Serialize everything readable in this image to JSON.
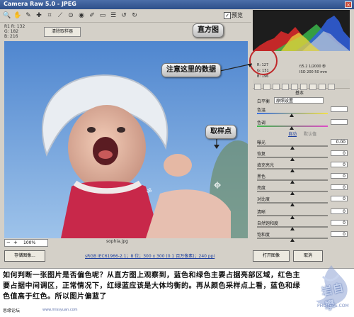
{
  "window": {
    "title": "Camera Raw 5.0 - JPEG",
    "close_glyph": "×",
    "preview_label": "预览",
    "preview_checked": "✓"
  },
  "toolbar": {
    "tools": [
      {
        "name": "zoom-tool-icon",
        "glyph": "🔍"
      },
      {
        "name": "hand-tool-icon",
        "glyph": "✋"
      },
      {
        "name": "white-balance-tool-icon",
        "glyph": "✎"
      },
      {
        "name": "color-sampler-tool-icon",
        "glyph": "✚"
      },
      {
        "name": "crop-tool-icon",
        "glyph": "⌗"
      },
      {
        "name": "straighten-tool-icon",
        "glyph": "⟋"
      },
      {
        "name": "spot-removal-tool-icon",
        "glyph": "⊙"
      },
      {
        "name": "red-eye-tool-icon",
        "glyph": "◉"
      },
      {
        "name": "adjustment-brush-icon",
        "glyph": "✐"
      },
      {
        "name": "gradient-filter-icon",
        "glyph": "▭"
      },
      {
        "name": "preferences-icon",
        "glyph": "☰"
      },
      {
        "name": "rotate-left-icon",
        "glyph": "↺"
      },
      {
        "name": "rotate-right-icon",
        "glyph": "↻"
      }
    ]
  },
  "sampler_info": {
    "line1": "R1  R: 132",
    "line2": "G: 182",
    "line3": "B: 216",
    "clear_button": "清除取样器"
  },
  "image": {
    "filename": "sophia.jpg",
    "zoom_minus": "−",
    "zoom_plus": "+",
    "zoom_value": "100%"
  },
  "bottom": {
    "save_button": "存储图像...",
    "link_info": "sRGB IEC61966-2.1；8 位；300 x 300 (0.1 百万像素)；240 ppi",
    "open_button": "打开图像",
    "cancel_button": "取消"
  },
  "right_panel": {
    "rgb_r": "R:  127",
    "rgb_g": "G:  151",
    "rgb_b": "B:  196",
    "exif_line1": "f/5.2    1/2000 秒",
    "exif_line2": "ISO 200    50 mm",
    "section_title": "基本",
    "wb_label": "白平衡",
    "wb_value": "原照设置",
    "params": [
      {
        "label": "色温",
        "value": ""
      },
      {
        "label": "色调",
        "value": ""
      },
      {
        "label": "曝光",
        "value": "0.00"
      },
      {
        "label": "恢复",
        "value": "0"
      },
      {
        "label": "填充亮光",
        "value": "0"
      },
      {
        "label": "黑色",
        "value": "0"
      },
      {
        "label": "亮度",
        "value": "0"
      },
      {
        "label": "对比度",
        "value": "0"
      },
      {
        "label": "清晰",
        "value": "0"
      },
      {
        "label": "自然饱和度",
        "value": "0"
      },
      {
        "label": "饱和度",
        "value": "0"
      }
    ],
    "auto_label": "自动",
    "default_label": "默认值"
  },
  "callouts": {
    "histogram": "直方图",
    "data_note": "注意这里的数据",
    "sample_point": "取样点"
  },
  "caption": {
    "text": "如何判断一张图片是否偏色呢？从直方图上观察到，蓝色和绿色主要占据亮部区域，红色主要占据中间调区，正常情况下，红绿蓝应该是大体均衡的。再从颜色采样点上看，蓝色和绿色值高于红色。所以图片偏蓝了"
  },
  "footer": {
    "forum": "思缘论坛",
    "url": "www.missyuan.com"
  },
  "watermark": {
    "text": "岩自學",
    "sub": "PHOTOPS.COM"
  },
  "colors": {
    "title_bar": "#2d4f8a",
    "panel_bg": "#d4d0c8",
    "sky_blue": "#7aa7db",
    "shirt_red": "#c8284a",
    "link_blue": "#1d3f9e",
    "callout_circle": "#c0282a"
  }
}
